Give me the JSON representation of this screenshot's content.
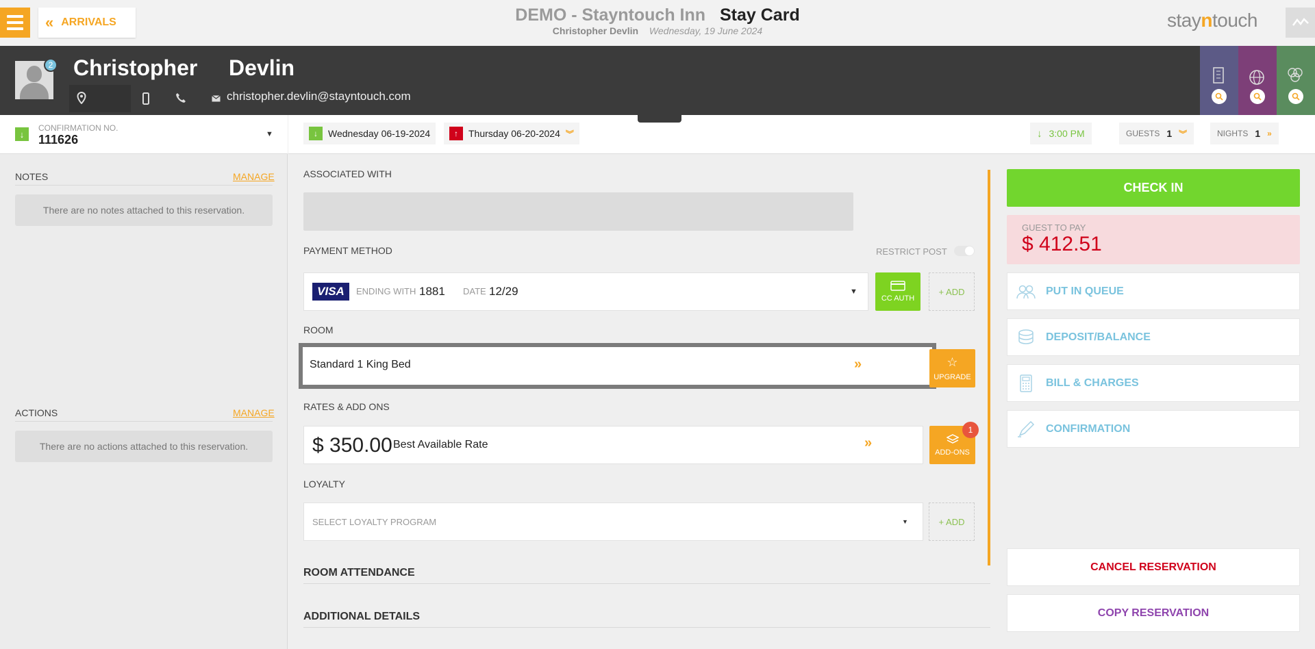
{
  "header": {
    "back_label": "ARRIVALS",
    "hotel_name": "DEMO - Stayntouch Inn",
    "page_title": "Stay Card",
    "guest_name": "Christopher Devlin",
    "business_date": "Wednesday, 19 June 2024",
    "logo_text_a": "stay",
    "logo_text_b": "n",
    "logo_text_c": "touch"
  },
  "guest": {
    "first_name": "Christopher",
    "last_name": "Devlin",
    "badge_count": "2",
    "email": "christopher.devlin@stayntouch.com"
  },
  "confirmation": {
    "label": "CONFIRMATION NO.",
    "number": "111626"
  },
  "notes": {
    "heading": "NOTES",
    "manage": "MANAGE",
    "empty": "There are no notes attached to this reservation."
  },
  "actions": {
    "heading": "ACTIONS",
    "manage": "MANAGE",
    "empty": "There are no actions attached to this reservation."
  },
  "stay_dates": {
    "arrival": "Wednesday 06-19-2024",
    "departure": "Thursday 06-20-2024",
    "arrival_time": "3:00 PM",
    "guests_label": "GUESTS",
    "guests": "1",
    "nights_label": "NIGHTS",
    "nights": "1"
  },
  "associated": {
    "label": "ASSOCIATED WITH"
  },
  "payment": {
    "label": "PAYMENT METHOD",
    "restrict_post": "RESTRICT POST",
    "card_brand": "VISA",
    "ending_label": "ENDING WITH",
    "ending": "1881",
    "date_label": "DATE",
    "date": "12/29",
    "cc_auth": "CC AUTH",
    "add": "+ ADD"
  },
  "room": {
    "label": "ROOM",
    "type": "Standard 1 King Bed",
    "upgrade": "UPGRADE"
  },
  "rates": {
    "label": "RATES & ADD ONS",
    "amount": "$ 350.00",
    "name": "Best Available Rate",
    "addons": "ADD-ONS",
    "addons_count": "1"
  },
  "loyalty": {
    "label": "LOYALTY",
    "placeholder": "SELECT LOYALTY PROGRAM",
    "add": "+ ADD"
  },
  "sections": {
    "room_attendance": "ROOM ATTENDANCE",
    "additional_details": "ADDITIONAL DETAILS"
  },
  "side_actions": {
    "check_in": "CHECK IN",
    "guest_to_pay_label": "GUEST TO PAY",
    "guest_to_pay": "$ 412.51",
    "put_in_queue": "PUT IN QUEUE",
    "deposit_balance": "DEPOSIT/BALANCE",
    "bill_charges": "BILL & CHARGES",
    "confirmation": "CONFIRMATION",
    "cancel": "CANCEL RESERVATION",
    "copy": "COPY RESERVATION"
  },
  "colors": {
    "accent": "#f5a623",
    "checkin": "#72d62e",
    "due": "#d0021b",
    "link": "#7ac3de",
    "cancel": "#d0021b",
    "copy": "#8e44ad"
  }
}
